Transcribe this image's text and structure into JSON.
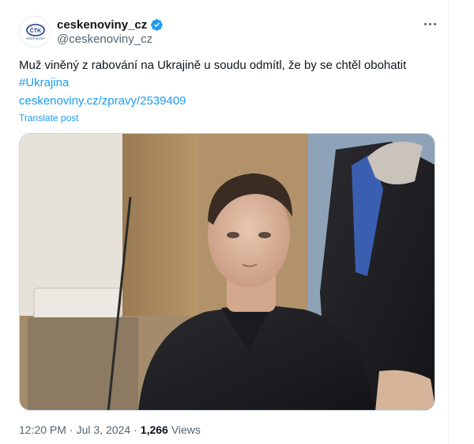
{
  "author": {
    "display_name": "ceskenoviny_cz",
    "handle": "@ceskenoviny_cz",
    "verified": true,
    "avatar_logo_text": "ČTK",
    "avatar_logo_subtext": "ČESKÉ NOVINY"
  },
  "post": {
    "text": "Muž viněný z rabování na Ukrajině u soudu odmítl, že by se chtěl obohatit",
    "hashtag": "#Ukrajina",
    "link": "ceskenoviny.cz/zpravy/2539409",
    "translate_label": "Translate post"
  },
  "meta": {
    "time": "12:20 PM",
    "separator": "·",
    "date": "Jul 3, 2024",
    "views_count": "1,266",
    "views_label": "Views"
  },
  "icons": {
    "verified": "verified-badge-icon",
    "more": "more-icon"
  },
  "colors": {
    "link": "#1d9bf0",
    "verified": "#1d9bf0",
    "secondary_text": "#536471",
    "primary_text": "#0f1419"
  }
}
